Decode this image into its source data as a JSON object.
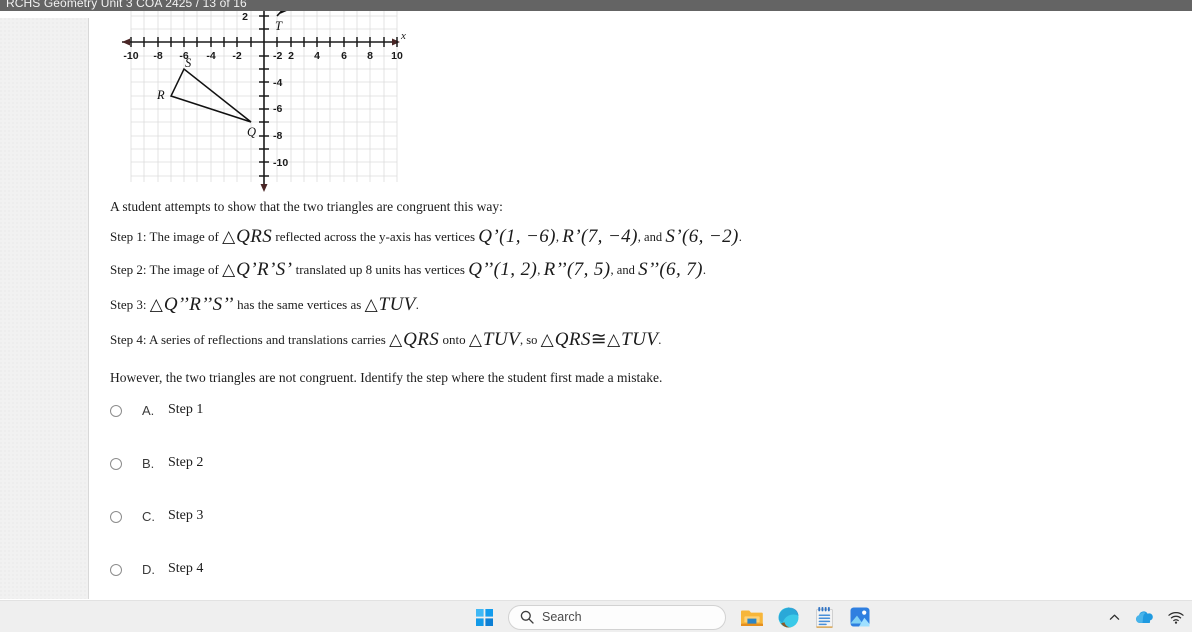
{
  "window": {
    "title": "RCHS Geometry Unit 3 COA 2425   / 13 of 16",
    "bar_color": "#646464"
  },
  "graph": {
    "x_axis_label": "x",
    "x_ticks": [
      "-10",
      "-8",
      "-6",
      "-4",
      "-2",
      "2",
      "4",
      "6",
      "8",
      "10"
    ],
    "y_ticks": [
      "2",
      "-2",
      "-4",
      "-6",
      "-8",
      "-10"
    ],
    "x_range": [
      -10,
      10
    ],
    "y_range": [
      -10,
      2
    ],
    "vertex_labels": [
      "S",
      "R",
      "Q",
      "T"
    ],
    "triangle_qrs": {
      "Q": [
        -1,
        -6
      ],
      "R": [
        -7,
        -4
      ],
      "S": [
        -6,
        -2
      ]
    },
    "triangle_tuv_visible_vertex": {
      "T": [
        1,
        2
      ]
    }
  },
  "question": {
    "intro": "A student attempts to show that the two triangles are congruent this way:",
    "steps": [
      {
        "label": "Step 1:",
        "p1": "The image of",
        "m1": "QRS",
        "p2": "reflected across the y-axis has vertices",
        "m2": "Q’(1, −6)",
        "p3": ",",
        "m3": "R’(7, −4)",
        "p4": ", and",
        "m4": "S’(6, −2)",
        "p5": "."
      },
      {
        "label": "Step 2:",
        "p1": "The image of",
        "m1": "Q’R’S’",
        "p2": "translated up 8 units has vertices",
        "m2": "Q’’(1, 2)",
        "p3": ",",
        "m3": "R’’(7, 5)",
        "p4": ", and",
        "m4": "S’’(6, 7)",
        "p5": "."
      },
      {
        "label": "Step 3:",
        "m1": "Q’’R’’S’’",
        "p2": "has the same vertices as",
        "m2": "TUV",
        "p3": "."
      },
      {
        "label": "Step 4:",
        "p1": "A series of reflections and translations carries",
        "m1": "QRS",
        "p2": "onto",
        "m2": "TUV",
        "p3": ", so",
        "m3": "QRS",
        "cong": "≅",
        "m4": "TUV",
        "p4": "."
      }
    ],
    "closing": "However, the two triangles are not congruent. Identify the step where the student first made a mistake.",
    "triangle_symbol": "△"
  },
  "options": [
    {
      "letter": "A.",
      "text": "Step 1",
      "selected": false
    },
    {
      "letter": "B.",
      "text": "Step 2",
      "selected": false
    },
    {
      "letter": "C.",
      "text": "Step 3",
      "selected": false
    },
    {
      "letter": "D.",
      "text": "Step 4",
      "selected": false
    }
  ],
  "taskbar": {
    "search_placeholder": "Search",
    "items": [
      {
        "name": "start-button",
        "icon": "windows-logo-icon"
      },
      {
        "name": "search-box",
        "icon": "search-icon"
      },
      {
        "name": "file-explorer-button",
        "icon": "folder-icon"
      },
      {
        "name": "microsoft-edge-button",
        "icon": "edge-icon"
      },
      {
        "name": "notepad-button",
        "icon": "notepad-icon"
      },
      {
        "name": "photos-button",
        "icon": "photos-icon"
      }
    ],
    "tray": [
      {
        "name": "show-hidden-icons-button",
        "icon": "chevron-up-icon"
      },
      {
        "name": "onedrive-button",
        "icon": "cloud-icon"
      },
      {
        "name": "network-button",
        "icon": "wifi-icon"
      }
    ]
  }
}
